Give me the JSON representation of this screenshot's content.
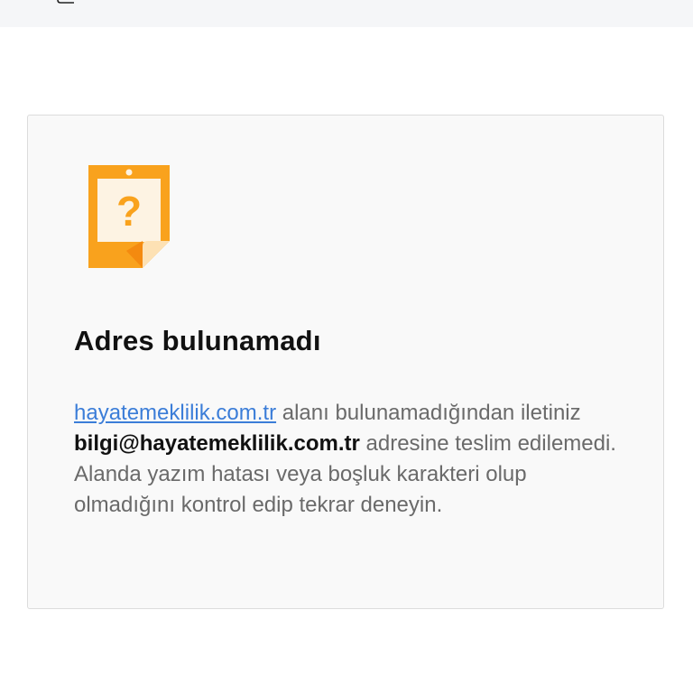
{
  "error_card": {
    "title": "Adres bulunamadı",
    "domain_link": "hayatemeklilik.com.tr",
    "text_part1": " alanı bulunamadığından iletiniz ",
    "email_address": "bilgi@hayatemeklilik.com.tr",
    "text_part2": " adresine teslim edilemedi. Alanda yazım hatası veya boşluk karakteri olup olmadığını kontrol edip tekrar deneyin."
  },
  "colors": {
    "accent_orange": "#f9a21d",
    "link_blue": "#3b7dd8"
  },
  "icons": {
    "top_bar": "edit-icon",
    "card": "note-question-icon"
  }
}
